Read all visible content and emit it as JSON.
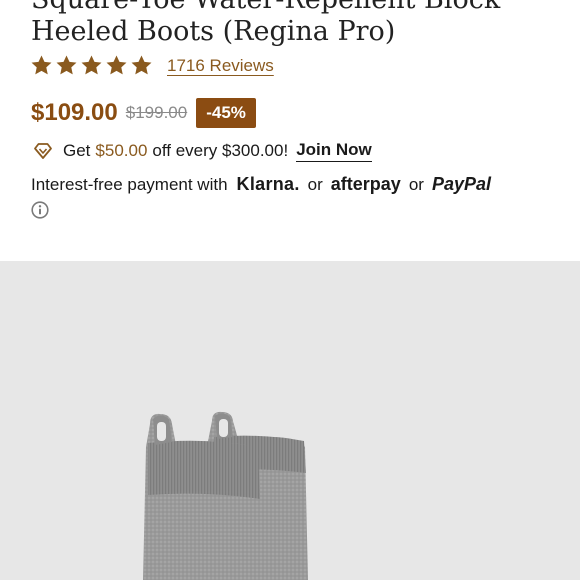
{
  "product": {
    "title": "Square-Toe Water-Repellent Block Heeled Boots (Regina Pro)",
    "rating_stars": 5,
    "reviews_label": "1716 Reviews"
  },
  "pricing": {
    "price": "$109.00",
    "original_price": "$199.00",
    "discount_badge": "-45%"
  },
  "promo": {
    "prefix": "Get",
    "amount": "$50.00",
    "suffix": "off every $300.00!",
    "join_label": "Join Now"
  },
  "payment": {
    "label": "Interest-free payment with",
    "providers": [
      "Klarna.",
      "afterpay",
      "PayPal"
    ],
    "separator": "or"
  },
  "icons": {
    "star": "star-icon",
    "diamond": "diamond-icon",
    "info": "info-icon"
  },
  "colors": {
    "accent": "#8b4c12",
    "star": "#8a5a1f",
    "image_bg": "#e7e7e7"
  }
}
